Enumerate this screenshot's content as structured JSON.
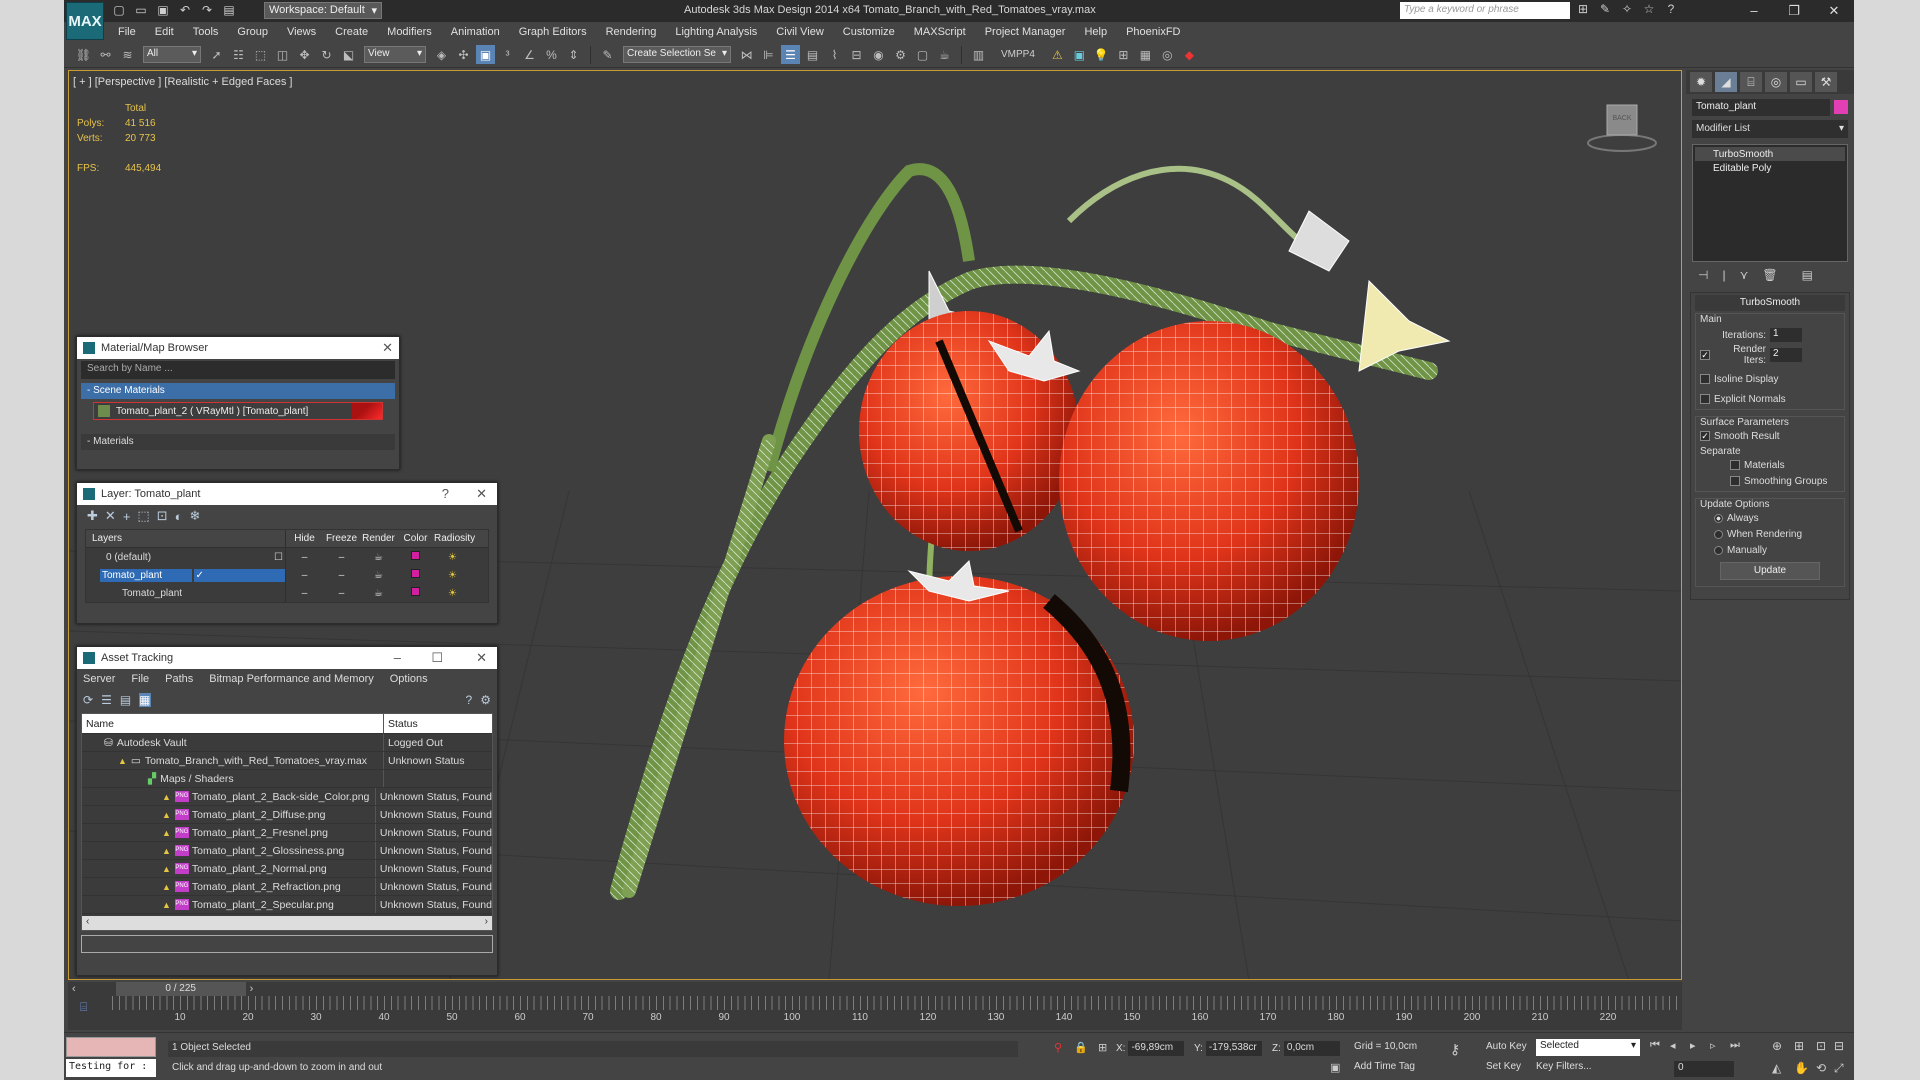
{
  "app": {
    "logo": "MAX",
    "workspace": "Workspace: Default",
    "title": "Autodesk 3ds Max Design 2014 x64     Tomato_Branch_with_Red_Tomatoes_vray.max",
    "search_placeholder": "Type a keyword or phrase"
  },
  "menu": [
    "File",
    "Edit",
    "Tools",
    "Group",
    "Views",
    "Create",
    "Modifiers",
    "Animation",
    "Graph Editors",
    "Rendering",
    "Lighting Analysis",
    "Civil View",
    "Customize",
    "MAXScript",
    "Project Manager",
    "Help",
    "PhoenixFD"
  ],
  "toolbar": {
    "filter": "All",
    "ref_coord": "View",
    "selection_set": "Create Selection Se",
    "vmpp": "VMPP4"
  },
  "viewport": {
    "label": "[ + ] [Perspective ] [Realistic + Edged Faces ]",
    "stats_header": "Total",
    "polys_label": "Polys:",
    "polys": "41 516",
    "verts_label": "Verts:",
    "verts": "20 773",
    "fps_label": "FPS:",
    "fps": "445,494",
    "viewcube_label": "BACK"
  },
  "material_browser": {
    "title": "Material/Map Browser",
    "search_placeholder": "Search by Name ...",
    "scene_section": "- Scene Materials",
    "item": "Tomato_plant_2  ( VRayMtl ) [Tomato_plant]",
    "materials_section": "- Materials"
  },
  "layer_manager": {
    "title": "Layer: Tomato_plant",
    "help": "?",
    "columns": [
      "Layers",
      "Hide",
      "Freeze",
      "Render",
      "Color",
      "Radiosity"
    ],
    "rows": [
      {
        "name": "0 (default)"
      },
      {
        "name": "Tomato_plant"
      },
      {
        "name": "Tomato_plant"
      }
    ]
  },
  "asset_tracking": {
    "title": "Asset Tracking",
    "menu": [
      "Server",
      "File",
      "Paths",
      "Bitmap Performance and Memory",
      "Options"
    ],
    "col_name": "Name",
    "col_status": "Status",
    "rows": [
      {
        "name": "Autodesk Vault",
        "status": "Logged Out"
      },
      {
        "name": "Tomato_Branch_with_Red_Tomatoes_vray.max",
        "status": "Unknown Status"
      },
      {
        "name": "Maps / Shaders",
        "status": ""
      },
      {
        "name": "Tomato_plant_2_Back-side_Color.png",
        "status": "Unknown Status, Found"
      },
      {
        "name": "Tomato_plant_2_Diffuse.png",
        "status": "Unknown Status, Found"
      },
      {
        "name": "Tomato_plant_2_Fresnel.png",
        "status": "Unknown Status, Found"
      },
      {
        "name": "Tomato_plant_2_Glossiness.png",
        "status": "Unknown Status, Found"
      },
      {
        "name": "Tomato_plant_2_Normal.png",
        "status": "Unknown Status, Found"
      },
      {
        "name": "Tomato_plant_2_Refraction.png",
        "status": "Unknown Status, Found"
      },
      {
        "name": "Tomato_plant_2_Specular.png",
        "status": "Unknown Status, Found"
      }
    ]
  },
  "command_panel": {
    "object_name": "Tomato_plant",
    "object_color": "#e23fb5",
    "modifier_list": "Modifier List",
    "stack": [
      "TurboSmooth",
      "Editable Poly"
    ],
    "rollout_title": "TurboSmooth",
    "main_label": "Main",
    "iterations_label": "Iterations:",
    "iterations": "1",
    "render_iters_label": "Render Iters:",
    "render_iters": "2",
    "isoline": "Isoline Display",
    "explicit_normals": "Explicit Normals",
    "surface_params": "Surface Parameters",
    "smooth_result": "Smooth Result",
    "separate": "Separate",
    "materials": "Materials",
    "smoothing_groups": "Smoothing Groups",
    "update_options": "Update Options",
    "always": "Always",
    "when_rendering": "When Rendering",
    "manually": "Manually",
    "update_button": "Update"
  },
  "timeline": {
    "frame": "0 / 225",
    "ticks": [
      "10",
      "20",
      "30",
      "40",
      "50",
      "60",
      "70",
      "80",
      "90",
      "100",
      "110",
      "120",
      "130",
      "140",
      "150",
      "160",
      "170",
      "180",
      "190",
      "200",
      "210",
      "220"
    ]
  },
  "status": {
    "listener": "Testing for :",
    "selection": "1 Object Selected",
    "prompt": "Click and drag up-and-down to zoom in and out",
    "x_label": "X:",
    "x": "-69,89cm",
    "y_label": "Y:",
    "y": "-179,538cr",
    "z_label": "Z:",
    "z": "0,0cm",
    "grid": "Grid = 10,0cm",
    "auto_key": "Auto Key",
    "selected": "Selected",
    "set_key": "Set Key",
    "key_filters": "Key Filters...",
    "add_time_tag": "Add Time Tag",
    "current_frame": "0"
  },
  "colors": {
    "accent": "#3c6ea8",
    "viewport_border": "#c99b33",
    "tomato": "#e8391c",
    "stem": "#6f9446"
  }
}
